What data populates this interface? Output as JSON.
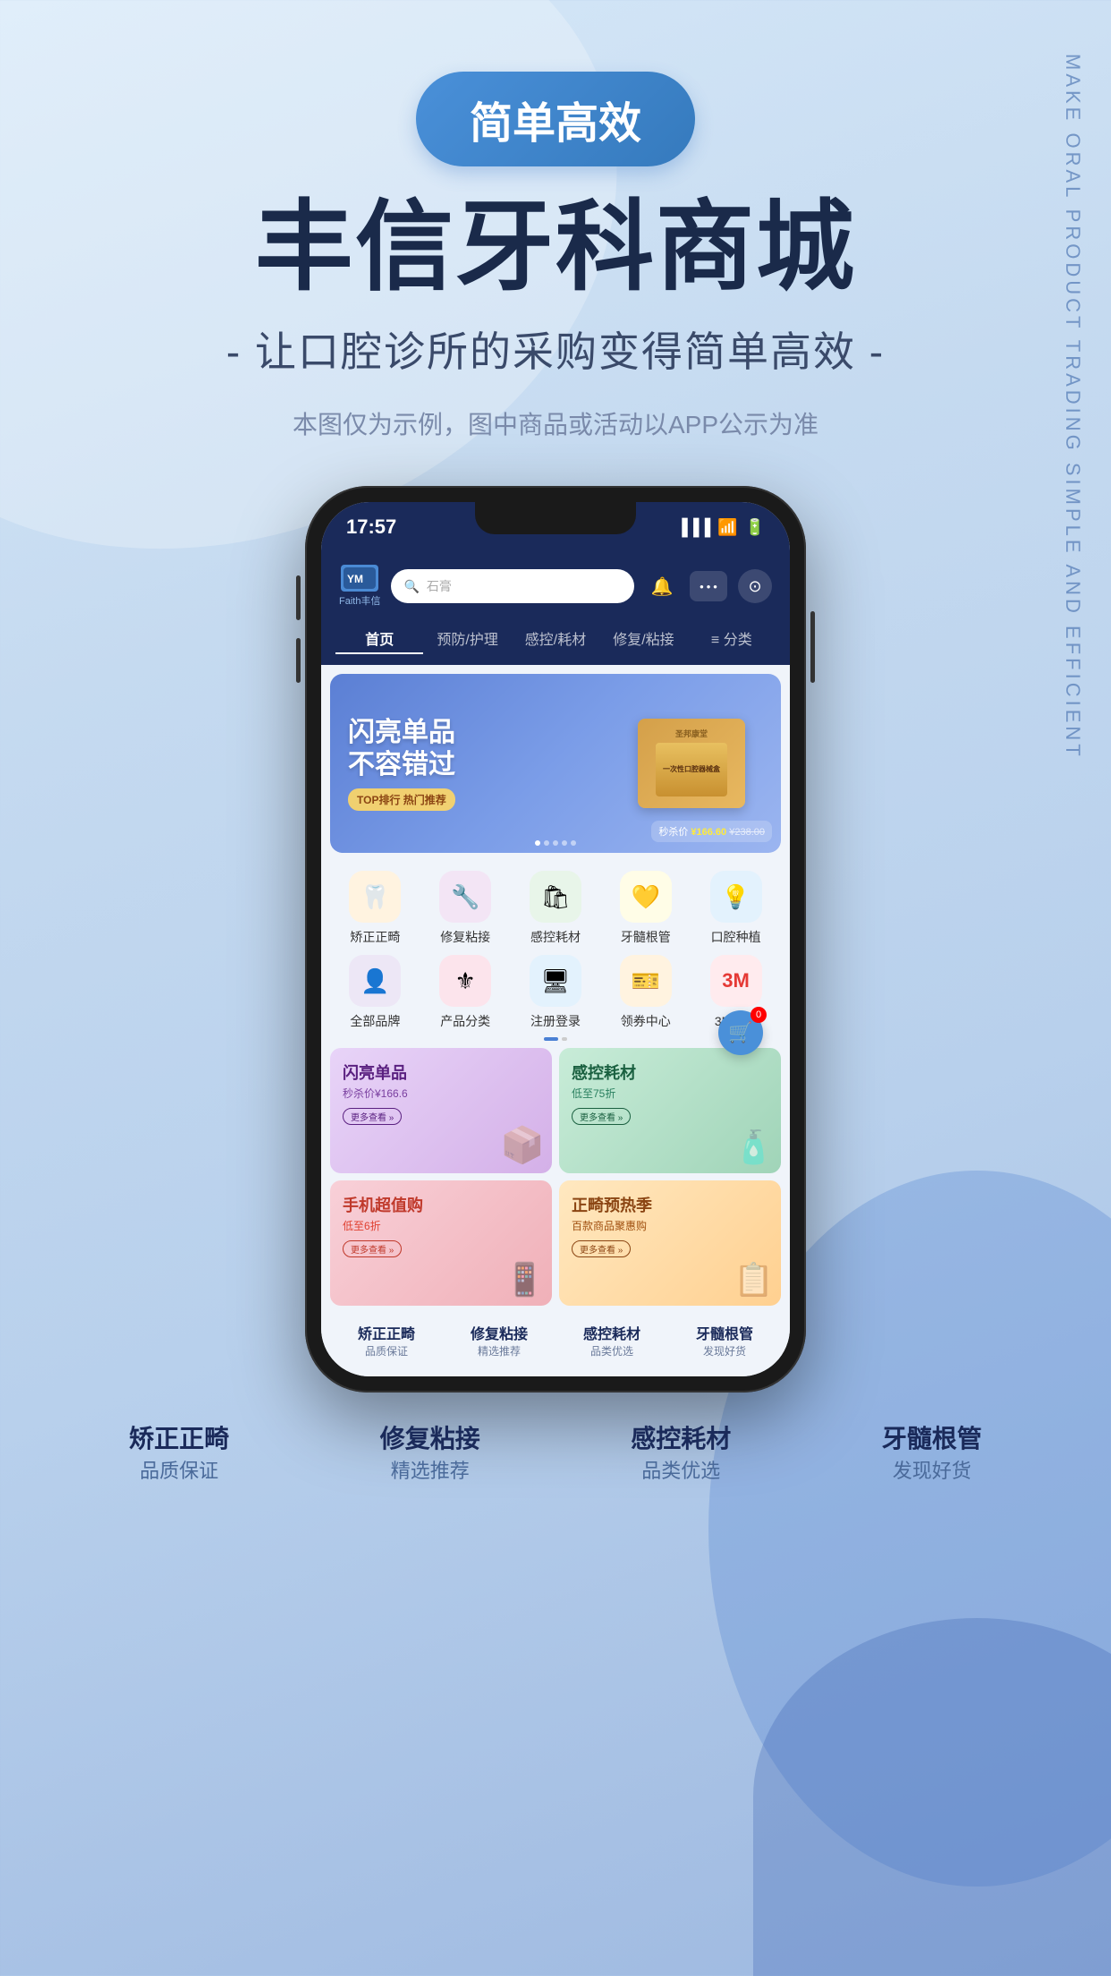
{
  "page": {
    "background_note": "light blue gradient background"
  },
  "vertical_text": "MAKE ORAL PRODUCT TRADING SIMPLE AND EFFICIENT",
  "hero": {
    "badge": "简单高效",
    "title": "丰信牙科商城",
    "subtitle": "- 让口腔诊所的采购变得简单高效 -",
    "disclaimer": "本图仅为示例，图中商品或活动以APP公示为准"
  },
  "phone": {
    "status_time": "17:57",
    "logo_icon": "YM",
    "logo_text": "Faith丰信",
    "search_placeholder": "石膏",
    "nav_tabs": [
      {
        "label": "首页",
        "active": true
      },
      {
        "label": "预防/护理",
        "active": false
      },
      {
        "label": "感控/耗材",
        "active": false
      },
      {
        "label": "修复/粘接",
        "active": false
      },
      {
        "label": "≡ 分类",
        "active": false
      }
    ],
    "banner": {
      "title_line1": "闪亮单品",
      "title_line2": "不容错过",
      "sub_label": "TOP排行 热门推荐",
      "product_name": "圣邦口腔器械盒",
      "price_current": "¥166.60",
      "price_original": "¥238.00",
      "price_label": "秒杀价"
    },
    "icon_rows": [
      [
        {
          "label": "矫正正畸",
          "color": "#f0a030",
          "bg": "#fff3e0"
        },
        {
          "label": "修复粘接",
          "color": "#9b59b6",
          "bg": "#f3e5f5"
        },
        {
          "label": "感控耗材",
          "color": "#27ae60",
          "bg": "#e8f5e9"
        },
        {
          "label": "牙髓根管",
          "color": "#e8b800",
          "bg": "#fffde7"
        },
        {
          "label": "口腔种植",
          "color": "#5b9bd5",
          "bg": "#e3f2fd"
        }
      ],
      [
        {
          "label": "全部品牌",
          "color": "#7b68ee",
          "bg": "#ede7f6"
        },
        {
          "label": "产品分类",
          "color": "#e91e8c",
          "bg": "#fce4ec"
        },
        {
          "label": "注册登录",
          "color": "#4a9fd4",
          "bg": "#e3f2fd"
        },
        {
          "label": "领券中心",
          "color": "#f08030",
          "bg": "#fff3e0"
        },
        {
          "label": "3M专区",
          "color": "#e53935",
          "bg": "#ffebee",
          "special": "3M"
        }
      ]
    ],
    "banner_cards": [
      {
        "title": "闪亮单品",
        "sub": "秒杀价¥166.6",
        "tag": "更多查看 »",
        "bg": "#e8d4f0",
        "title_color": "#5a2080"
      },
      {
        "title": "感控耗材",
        "sub": "低至75折",
        "tag": "更多查看 »",
        "bg": "#d4f0e0",
        "title_color": "#1a6040"
      },
      {
        "title": "手机超值购",
        "sub": "低至6折",
        "tag": "更多查看 »",
        "bg": "#f0d4da",
        "title_color": "#c0392b"
      },
      {
        "title": "正畸预热季",
        "sub": "百款商品聚惠购",
        "tag": "更多查看 »",
        "bg": "#ffefd4",
        "title_color": "#8B4513"
      }
    ],
    "bottom_items": [
      {
        "title": "矫正正畸",
        "sub": "品质保证"
      },
      {
        "title": "修复粘接",
        "sub": "精选推荐"
      },
      {
        "title": "感控耗材",
        "sub": "品类优选"
      },
      {
        "title": "牙髓根管",
        "sub": "发现好货"
      }
    ]
  },
  "bottom_labels": [
    {
      "main": "矫正正畸",
      "sub": "品质保证"
    },
    {
      "main": "修复粘接",
      "sub": "精选推荐"
    },
    {
      "main": "感控耗材",
      "sub": "品类优选"
    },
    {
      "main": "牙髓根管",
      "sub": "发现好货"
    }
  ]
}
